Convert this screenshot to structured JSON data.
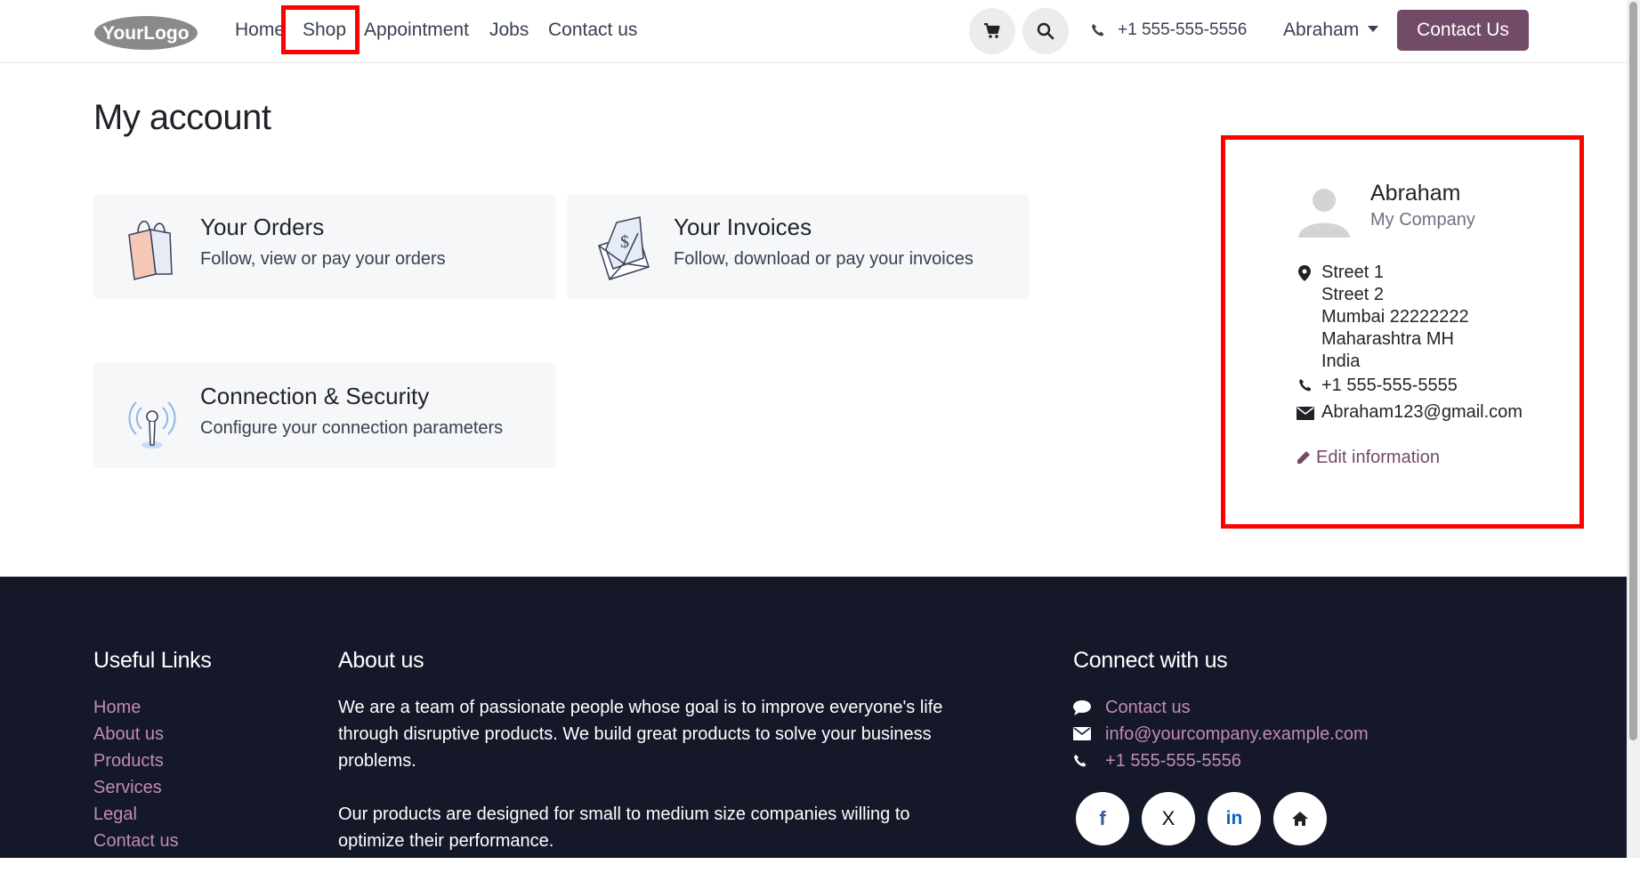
{
  "header": {
    "logo_text": "YourLogo",
    "nav": [
      {
        "label": "Home"
      },
      {
        "label": "Shop"
      },
      {
        "label": "Appointment"
      },
      {
        "label": "Jobs"
      },
      {
        "label": "Contact us"
      }
    ],
    "phone": "+1 555-555-5556",
    "user": "Abraham",
    "contact_button": "Contact Us"
  },
  "main": {
    "title": "My account",
    "cards": [
      {
        "title": "Your Orders",
        "desc": "Follow, view or pay your orders",
        "icon": "shopping-bag-icon"
      },
      {
        "title": "Your Invoices",
        "desc": "Follow, download or pay your invoices",
        "icon": "invoice-envelope-icon"
      },
      {
        "title": "Connection & Security",
        "desc": "Configure your connection parameters",
        "icon": "antenna-icon"
      }
    ]
  },
  "profile": {
    "name": "Abraham",
    "company": "My Company",
    "address": [
      "Street 1",
      "Street 2",
      "Mumbai 22222222",
      "Maharashtra MH",
      "India"
    ],
    "phone": "+1 555-555-5555",
    "email": "Abraham123@gmail.com",
    "edit_label": "Edit information"
  },
  "footer": {
    "useful_links_title": "Useful Links",
    "useful_links": [
      "Home",
      "About us",
      "Products",
      "Services",
      "Legal",
      "Contact us"
    ],
    "about_title": "About us",
    "about_p1": "We are a team of passionate people whose goal is to improve everyone's life through disruptive products. We build great products to solve your business problems.",
    "about_p2": "Our products are designed for small to medium size companies willing to optimize their performance.",
    "connect_title": "Connect with us",
    "connect_contact": "Contact us",
    "connect_email": "info@yourcompany.example.com",
    "connect_phone": "+1 555-555-5556",
    "social": [
      "f",
      "X",
      "in"
    ]
  },
  "colors": {
    "accent": "#714b67",
    "footer_bg": "#141829",
    "footer_link": "#c28bb4",
    "highlight": "#ff0000"
  }
}
